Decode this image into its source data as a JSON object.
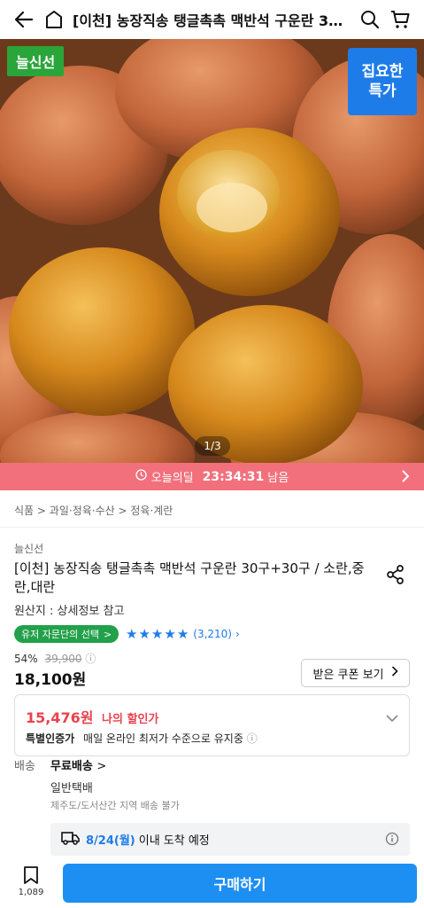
{
  "header": {
    "title": "[이천] 농장직송 탱글촉촉 맥반석 구운란 3…"
  },
  "hero": {
    "badge_left": "늘신선",
    "badge_right_line1": "집요한",
    "badge_right_line2": "특가",
    "pager": "1/3"
  },
  "deal": {
    "label": "오늘의딜",
    "time": "23:34:31",
    "suffix": "남음"
  },
  "breadcrumb": {
    "c1": "식품",
    "c2": "과일·정육·수산",
    "c3": "정육·계란"
  },
  "product": {
    "brand": "늘신선",
    "title": "[이천] 농장직송 탱글촉촉 맥반석 구운란 30구+30구 / 소란,중란,대란",
    "origin": "원산지 : 상세정보 참고",
    "choice_badge": "유저 자문단의 선택",
    "rating_count": "(3,210)",
    "discount_rate": "54%",
    "original_price": "39,900",
    "price": "18,100원",
    "coupon_button": "받은 쿠폰 보기"
  },
  "my_price": {
    "amount": "15,476원",
    "label": "나의 할인가",
    "cert_label": "특별인증가",
    "cert_desc": "매일 온라인 최저가 수준으로 유지중"
  },
  "shipping": {
    "label": "배송",
    "fee": "무료배송",
    "method": "일반택배",
    "note": "제주도/도서산간 지역 배송 불가",
    "arrival_date": "8/24(월)",
    "arrival_text": "이내 도착 예정"
  },
  "bottom": {
    "wish_count": "1,089",
    "buy_button": "구매하기"
  },
  "colors": {
    "accent_blue": "#1e8ff2",
    "deal_pink": "#f2707c",
    "discount_red": "#e8434e",
    "badge_green": "#2aa53a"
  }
}
